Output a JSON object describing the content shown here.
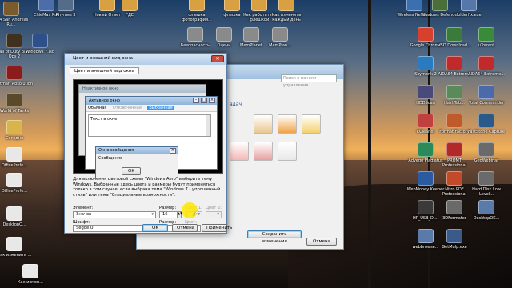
{
  "desktop_icons_left": [
    {
      "label": "GTA San Andreas Ru...",
      "color": "#7a5b2e"
    },
    {
      "label": "Call of Duty Black Ops 2",
      "color": "#40301e"
    },
    {
      "label": "Windows 7.iso",
      "color": "#2d4f8a"
    },
    {
      "label": "Hitman Absolution",
      "color": "#8b1c1c"
    },
    {
      "label": "World of Tanks",
      "color": "#5b4a2a"
    },
    {
      "label": "Сегодня",
      "color": "#d9b44a"
    },
    {
      "label": "OfficeProfe...",
      "color": "#e8e8e8"
    },
    {
      "label": "OfficeProfe...",
      "color": "#e8e8e8"
    },
    {
      "label": "DesktopO...",
      "color": "#e8e8e8"
    },
    {
      "label": "Как изменить ...",
      "color": "#e8e8e8"
    },
    {
      "label": "Как измен...",
      "color": "#e8e8e8"
    }
  ],
  "desktop_icons_top": [
    {
      "label": "ChieMax Rus",
      "color": "#4c6da8"
    },
    {
      "label": "Rhymes 3",
      "color": "#556b8a"
    },
    {
      "label": "Новый Ответ",
      "color": "#d8a040"
    },
    {
      "label": "ГДЕ",
      "color": "#d8a040"
    },
    {
      "label": "флешка фотография...",
      "color": "#d8a040"
    },
    {
      "label": "флешка",
      "color": "#d8a040"
    },
    {
      "label": "Как работать с флешкой",
      "color": "#d8a040"
    },
    {
      "label": "Как изменить каждый день",
      "color": "#d8a040"
    }
  ],
  "desktop_icons_mid": [
    {
      "label": "Безопасность",
      "color": "#8a8a8a"
    },
    {
      "label": "Оцени",
      "color": "#8a8a8a"
    },
    {
      "label": "MemPlanet",
      "color": "#8a8a8a"
    },
    {
      "label": "MemPlan...",
      "color": "#8a8a8a"
    }
  ],
  "desktop_icons_right": [
    {
      "label": "Wireless Netwo...",
      "color": "#3a6fb0"
    },
    {
      "label": "Windows Defender",
      "color": "#4a6f3a"
    },
    {
      "label": "folderfix.exe",
      "color": "#5577aa"
    },
    {
      "label": "Google Chrome",
      "color": "#d6402c"
    },
    {
      "label": "VSO Download...",
      "color": "#3a7a3a"
    },
    {
      "label": "uTorrent",
      "color": "#3a8a3a"
    },
    {
      "label": "Skymonk 2",
      "color": "#2a7ac0"
    },
    {
      "label": "AIDA64 Extreme",
      "color": "#c02a2a"
    },
    {
      "label": "AIDA64 Extreme...",
      "color": "#c02a2a"
    },
    {
      "label": "HDDScan",
      "color": "#4a4a7a"
    },
    {
      "label": "HashTab...",
      "color": "#5a8a5a"
    },
    {
      "label": "Total Commander",
      "color": "#4a6aaa"
    },
    {
      "label": "CCleaner",
      "color": "#c04040"
    },
    {
      "label": "Format Factory",
      "color": "#c05a2a"
    },
    {
      "label": "FastStone Capture",
      "color": "#2a5a8a"
    },
    {
      "label": "Advego Plagiatus",
      "color": "#2a8a5a"
    },
    {
      "label": "PROMT Professional",
      "color": "#b02a2a"
    },
    {
      "label": "GeoWebinar",
      "color": "#6a6a6a"
    },
    {
      "label": "WebMoney Keeper",
      "color": "#2a5aa0"
    },
    {
      "label": "Nitro PDF Professional",
      "color": "#c04a2a"
    },
    {
      "label": "Hard Disk Low Level...",
      "color": "#6a6a6a"
    },
    {
      "label": "HP_USB_Di...",
      "color": "#3a3a3a"
    },
    {
      "label": "3DFormater",
      "color": "#6a6a6a"
    },
    {
      "label": "DesktopOK...",
      "color": "#5a7aaa"
    },
    {
      "label": "webbrowse...",
      "color": "#5a7aaa"
    },
    {
      "label": "GetMulp.exe",
      "color": "#3a5a8a"
    }
  ],
  "personalization": {
    "search_placeholder": "Поиск в панели управления",
    "partial_label": "адач",
    "save_button": "Сохранить изменения",
    "cancel_button": "Отмена",
    "swatch_colors": [
      "#f2f2f2",
      "#f7f7f7",
      "#e8c890",
      "#f0a34a",
      "#f5d070",
      "#f5b8b8",
      "#e6a0a0",
      "#e8e8e8"
    ]
  },
  "dialog": {
    "title": "Цвет и внешний вид окна",
    "tab": "Цвет и внешний вид окна",
    "preview": {
      "inactive_title": "Неактивное окно",
      "active_title": "Активное окно",
      "menu_normal": "Обычная",
      "menu_disabled": "Отключенная",
      "menu_selected": "Выбранная",
      "window_text": "Текст в окне",
      "msgbox_title": "Окно сообщения",
      "msgbox_text": "Сообщение",
      "msgbox_ok": "OK"
    },
    "description": "Для включения цветовой схемы \"Windows Aero\" выберите тему Windows. Выбранные здесь цвета и размеры будут применяться только в том случае, если выбрана тема \"Windows 7 - упрощенный стиль\" или тема \"Специальные возможности\".",
    "element_label": "Элемент:",
    "element_value": "Значок",
    "size_label": "Размер:",
    "size_value": "16",
    "color1_label": "Цвет 1:",
    "color2_label": "Цвет 2:",
    "font_label": "Шрифт:",
    "font_value": "Segoe UI",
    "font_size_label": "Размер:",
    "font_size_value": "9",
    "font_color_label": "Цвет:",
    "bold_label": "Ж",
    "italic_label": "К",
    "ok_button": "OK",
    "cancel_button": "Отмена",
    "apply_button": "Применить"
  }
}
